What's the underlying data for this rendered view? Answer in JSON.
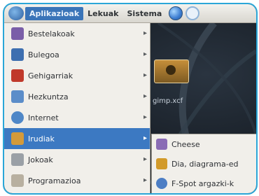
{
  "panel": {
    "menu_applications": "Aplikazioak",
    "menu_places": "Lekuak",
    "menu_system": "Sistema",
    "icons": [
      "distro-logo-icon",
      "web-browser-icon",
      "help-icon"
    ]
  },
  "applications_menu": {
    "items": [
      {
        "label": "Bestelakoak",
        "icon": "other-apps-icon",
        "color": "#7a5ea8"
      },
      {
        "label": "Bulegoa",
        "icon": "office-icon",
        "color": "#3e6fb0"
      },
      {
        "label": "Gehigarriak",
        "icon": "accessories-icon",
        "color": "#c0392b"
      },
      {
        "label": "Hezkuntza",
        "icon": "education-icon",
        "color": "#5b8dc9"
      },
      {
        "label": "Internet",
        "icon": "internet-icon",
        "color": "#4f87c7"
      },
      {
        "label": "Irudiak",
        "icon": "graphics-icon",
        "color": "#d49a3a",
        "selected": true
      },
      {
        "label": "Jokoak",
        "icon": "games-icon",
        "color": "#9aa0a6"
      },
      {
        "label": "Programazioa",
        "icon": "programming-icon",
        "color": "#b8b0a0"
      }
    ]
  },
  "submenu": {
    "items": [
      {
        "label": "Cheese",
        "icon": "cheese-webcam-icon",
        "color": "#8a6cb5"
      },
      {
        "label": "Dia, diagrama-ed",
        "icon": "dia-diagram-icon",
        "color": "#d29a2a"
      },
      {
        "label": "F-Spot argazki-k",
        "icon": "f-spot-photo-icon",
        "color": "#4d7ec4"
      }
    ]
  },
  "desktop": {
    "file_label": "gimp.xcf"
  },
  "colors": {
    "highlight": "#3c79c2",
    "frame": "#2aa6d8",
    "menu_bg": "#f1efea"
  }
}
